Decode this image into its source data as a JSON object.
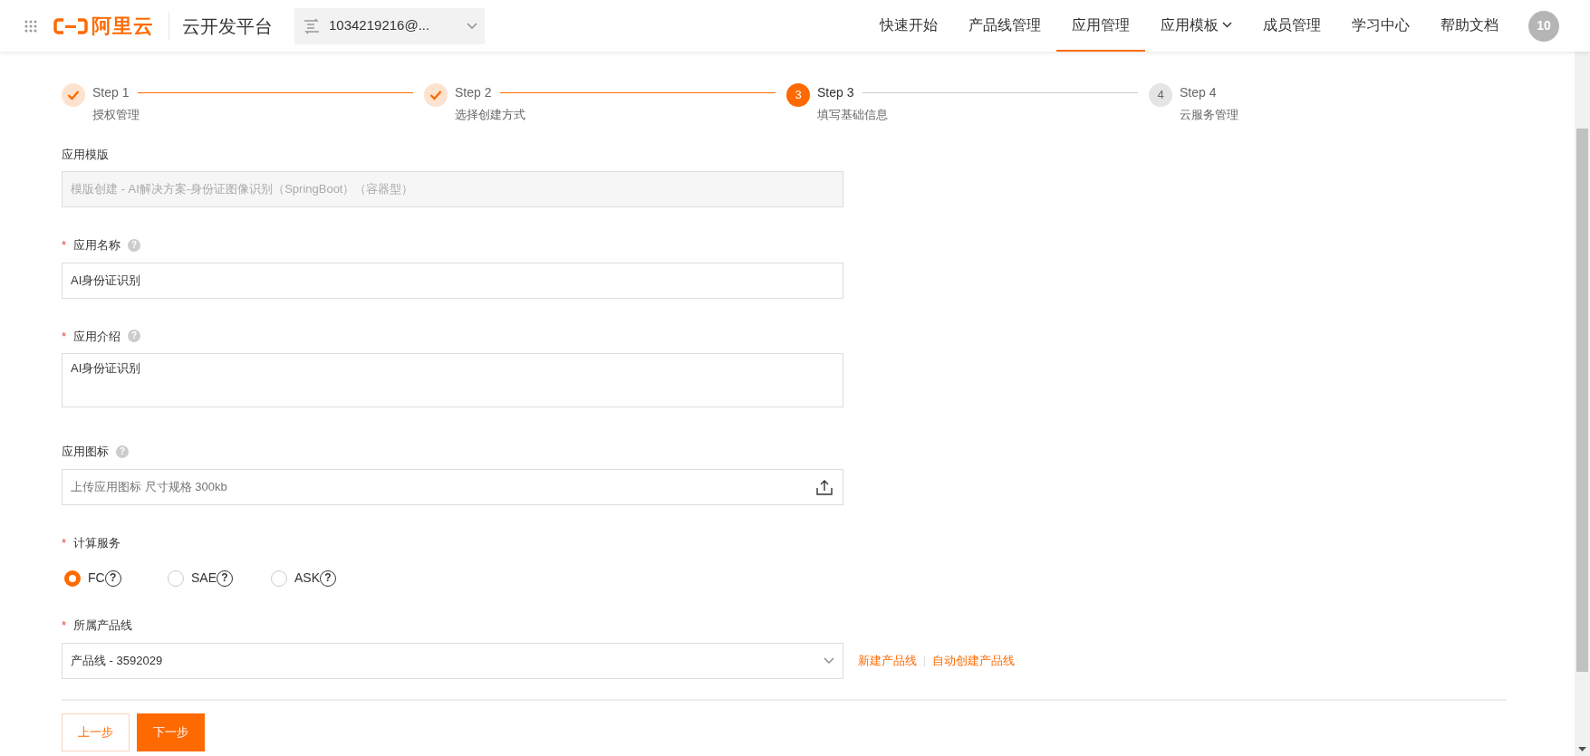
{
  "header": {
    "brand": "阿里云",
    "platform": "云开发平台",
    "account": "1034219216@...",
    "nav": [
      {
        "label": "快速开始",
        "selected": false,
        "dropdown": false
      },
      {
        "label": "产品线管理",
        "selected": false,
        "dropdown": false
      },
      {
        "label": "应用管理",
        "selected": true,
        "dropdown": false
      },
      {
        "label": "应用模板",
        "selected": false,
        "dropdown": true
      },
      {
        "label": "成员管理",
        "selected": false,
        "dropdown": false
      },
      {
        "label": "学习中心",
        "selected": false,
        "dropdown": false
      },
      {
        "label": "帮助文档",
        "selected": false,
        "dropdown": false
      }
    ],
    "avatar": "10"
  },
  "steps": [
    {
      "title": "Step 1",
      "subtitle": "授权管理",
      "done": true,
      "selected": false
    },
    {
      "title": "Step 2",
      "subtitle": "选择创建方式",
      "done": true,
      "selected": false
    },
    {
      "title": "Step 3",
      "subtitle": "填写基础信息",
      "done": false,
      "selected": true,
      "number": "3"
    },
    {
      "title": "Step 4",
      "subtitle": "云服务管理",
      "done": false,
      "selected": false,
      "number": "4"
    }
  ],
  "form": [
    {
      "kind": "readonly",
      "label": "应用模版",
      "disabled": true,
      "value": "模版创建 - AI解决方案-身份证图像识别（SpringBoot）（容器型）"
    },
    {
      "kind": "text",
      "label": "应用名称",
      "required_mark": "*",
      "help": "?",
      "value": "AI身份证识别"
    },
    {
      "kind": "textarea",
      "label": "应用介绍",
      "required_mark": "*",
      "help": "?",
      "value": "AI身份证识别"
    },
    {
      "kind": "upload",
      "label": "应用图标",
      "help": "?",
      "placeholder": "上传应用图标 尺寸规格 300kb"
    },
    {
      "kind": "radio",
      "label": "计算服务",
      "required_mark": "*",
      "options": [
        {
          "label": "FC",
          "help": "?",
          "selected": true
        },
        {
          "label": "SAE",
          "help": "?",
          "selected": false
        },
        {
          "label": "ASK",
          "help": "?",
          "selected": false
        }
      ]
    },
    {
      "kind": "select",
      "label": "所属产品线",
      "required_mark": "*",
      "value": "产品线 - 3592029",
      "links": [
        "新建产品线",
        "自动创建产品线"
      ]
    }
  ],
  "buttons": {
    "prev": "上一步",
    "next": "下一步"
  }
}
